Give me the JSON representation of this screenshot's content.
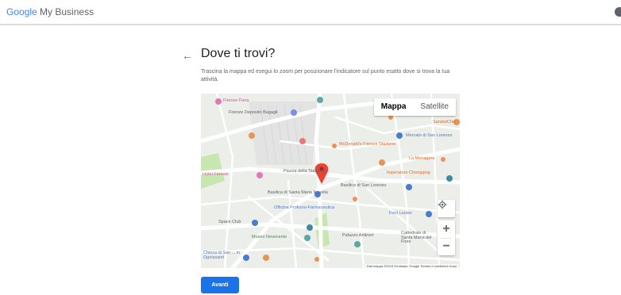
{
  "header": {
    "brand_google": "Google",
    "brand_product": "My Business"
  },
  "page": {
    "title": "Dove ti trovi?",
    "description": "Trascina la mappa ed esegui lo zoom per posizionare l'indicatore sul punto esatto dove si trova la tua attività."
  },
  "map": {
    "type_options": [
      "Mappa",
      "Satellite"
    ],
    "selected_type": "Mappa",
    "attribution": "Dati mappa ©2019 Geobasis, Google   Termini e condizioni d'uso",
    "labels": {
      "firenze_fiera": "Firenze Fiera",
      "deposito": "Firenze Deposito Bagagli",
      "mercato": "Mercato di San Lorenzo",
      "piazza_stazione": "Piazza della Stazione",
      "basilica_san_lorenzo": "Basilica di San Lorenzo",
      "santa_maria_novella": "Basilica di Santa Maria Novella",
      "officina": "Officina Profumo-Farmaceutica",
      "foot_locker": "Foot Locker",
      "museo_novecento": "Museo Novecento",
      "palazzo_antinori": "Palazzo Antinori",
      "cattedrale": "Cattedrale di Santa Maria del Fiore",
      "chiesa_ognissanti": "Chiesa di San ... in Ognissanti",
      "space_club": "Space Club",
      "mcdonalds": "McDonald's Firenze Stazione",
      "imperatore": "Imperatore Chongqing",
      "hotel": "Hotel Firenze",
      "sandwichic": "SandwiChic",
      "la_menagere": "La Menagere"
    },
    "colors": {
      "marker": "#ea4335",
      "road": "#ffffff",
      "park": "#c8e6b0",
      "land": "#eceeea"
    }
  },
  "actions": {
    "next_label": "Avanti"
  }
}
